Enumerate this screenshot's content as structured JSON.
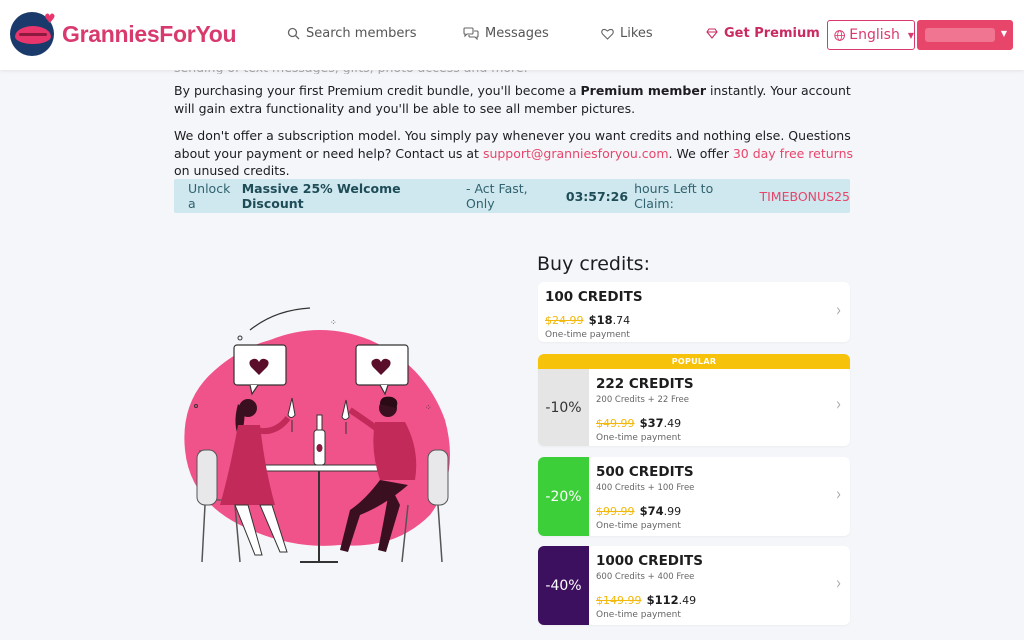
{
  "header": {
    "logo_text": "GranniesForYou",
    "nav": {
      "search": "Search members",
      "messages": "Messages",
      "likes": "Likes",
      "premium": "Get Premium"
    },
    "language": "English"
  },
  "content": {
    "cutoff_line": "sending of text messages, gifts, photo access and more.",
    "p1_a": "By purchasing your first Premium credit bundle, you'll become a ",
    "p1_bold": "Premium member",
    "p1_b": " instantly. Your account will gain extra functionality and you'll be able to see all member pictures.",
    "p2_a": "We don't offer a subscription model. You simply pay whenever you want credits and nothing else. Questions about your payment or need help? Contact us at ",
    "p2_email": "support@granniesforyou.com",
    "p2_b": ". We offer ",
    "p2_returns": "30 day free returns",
    "p2_c": " on unused credits."
  },
  "promo": {
    "prefix": "Unlock a ",
    "bold": "Massive 25% Welcome Discount",
    "middle": " - Act Fast, Only ",
    "timer": "03:57:26",
    "suffix": " hours Left to Claim: ",
    "code": "TIMEBONUS25"
  },
  "credits": {
    "title": "Buy credits:",
    "popular_label": "POPULAR",
    "packages": [
      {
        "title": "100 CREDITS",
        "old": "$24.99",
        "new_main": "$18",
        "new_cents": ".74",
        "payment": "One-time payment"
      },
      {
        "discount": "-10%",
        "title": "222 CREDITS",
        "sub": "200 Credits + 22 Free",
        "old": "$49.99",
        "new_main": "$37",
        "new_cents": ".49",
        "payment": "One-time payment"
      },
      {
        "discount": "-20%",
        "title": "500 CREDITS",
        "sub": "400 Credits + 100 Free",
        "old": "$99.99",
        "new_main": "$74",
        "new_cents": ".99",
        "payment": "One-time payment"
      },
      {
        "discount": "-40%",
        "title": "1000 CREDITS",
        "sub": "600 Credits + 400 Free",
        "old": "$149.99",
        "new_main": "$112",
        "new_cents": ".49",
        "payment": "One-time payment"
      }
    ]
  },
  "colors": {
    "brand": "#d93a6d",
    "accent": "#e8456b",
    "promo_bg": "#cfe7ee",
    "popular": "#f6c20a",
    "disc_20": "#3dcf3a",
    "disc_40": "#3d0f5f"
  },
  "icons": {
    "search": "search-icon",
    "messages": "chat-bubbles-icon",
    "likes": "heart-icon",
    "premium": "diamond-icon",
    "language": "globe-icon",
    "chevron": "chevron-right-icon"
  }
}
